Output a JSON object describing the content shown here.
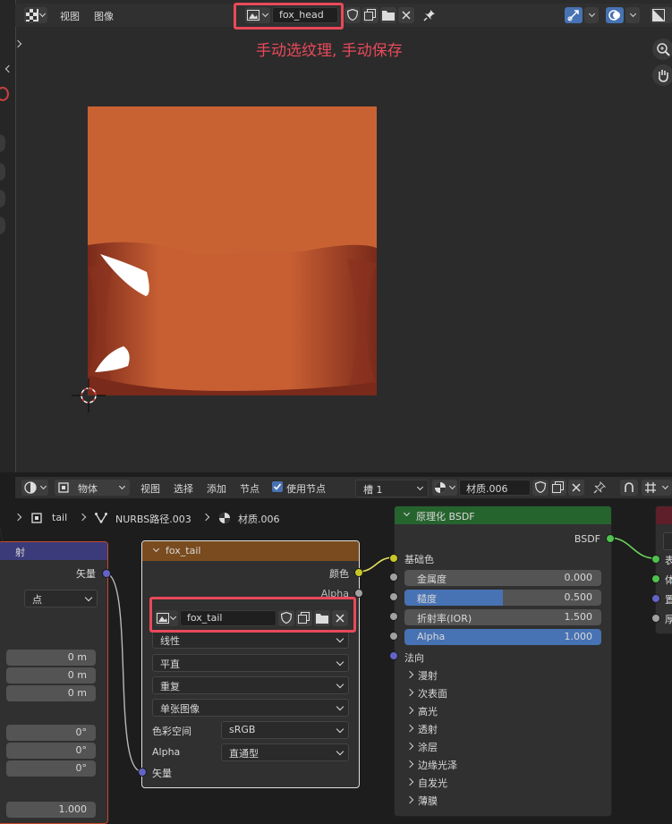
{
  "image_editor": {
    "menu_view": "视图",
    "menu_image": "图像",
    "image_name": "fox_head",
    "annotation": "手动选纹理, 手动保存"
  },
  "node_editor": {
    "editor_type": "物体",
    "menu_view": "视图",
    "menu_select": "选择",
    "menu_add": "添加",
    "menu_node": "节点",
    "use_nodes_label": "使用节点",
    "slot": "槽 1",
    "material_name": "材质.006",
    "breadcrumb": [
      "tail",
      "NURBS路径.003",
      "材质.006"
    ]
  },
  "left_node": {
    "title": "射",
    "vector_label": "矢量",
    "point_option": "点",
    "loc": [
      "0 m",
      "0 m",
      "0 m"
    ],
    "rot": [
      "0°",
      "0°",
      "0°"
    ],
    "scale_value": "1.000"
  },
  "image_node": {
    "title": "fox_tail",
    "out_color": "颜色",
    "out_alpha": "Alpha",
    "image_name": "fox_tail",
    "interpolation": "线性",
    "projection": "平直",
    "extension": "重复",
    "source": "单张图像",
    "colorspace_label": "色彩空间",
    "colorspace_value": "sRGB",
    "alpha_label": "Alpha",
    "alpha_value": "直通型",
    "vector_label": "矢量"
  },
  "bsdf_node": {
    "title": "原理化 BSDF",
    "output": "BSDF",
    "base_color": "基础色",
    "fields": [
      {
        "label": "金属度",
        "value": "0.000",
        "fill": 0.0
      },
      {
        "label": "糙度",
        "value": "0.500",
        "fill": 0.5
      },
      {
        "label": "折射率(IOR)",
        "value": "1.500",
        "fill": 0.0
      },
      {
        "label": "Alpha",
        "value": "1.000",
        "fill": 1.0
      }
    ],
    "normal": "法向",
    "panels": [
      "漫射",
      "次表面",
      "高光",
      "透射",
      "涂层",
      "边缘光泽",
      "自发光",
      "薄膜"
    ]
  },
  "output_node": {
    "labels": [
      "表",
      "体",
      "置",
      "厚"
    ]
  }
}
